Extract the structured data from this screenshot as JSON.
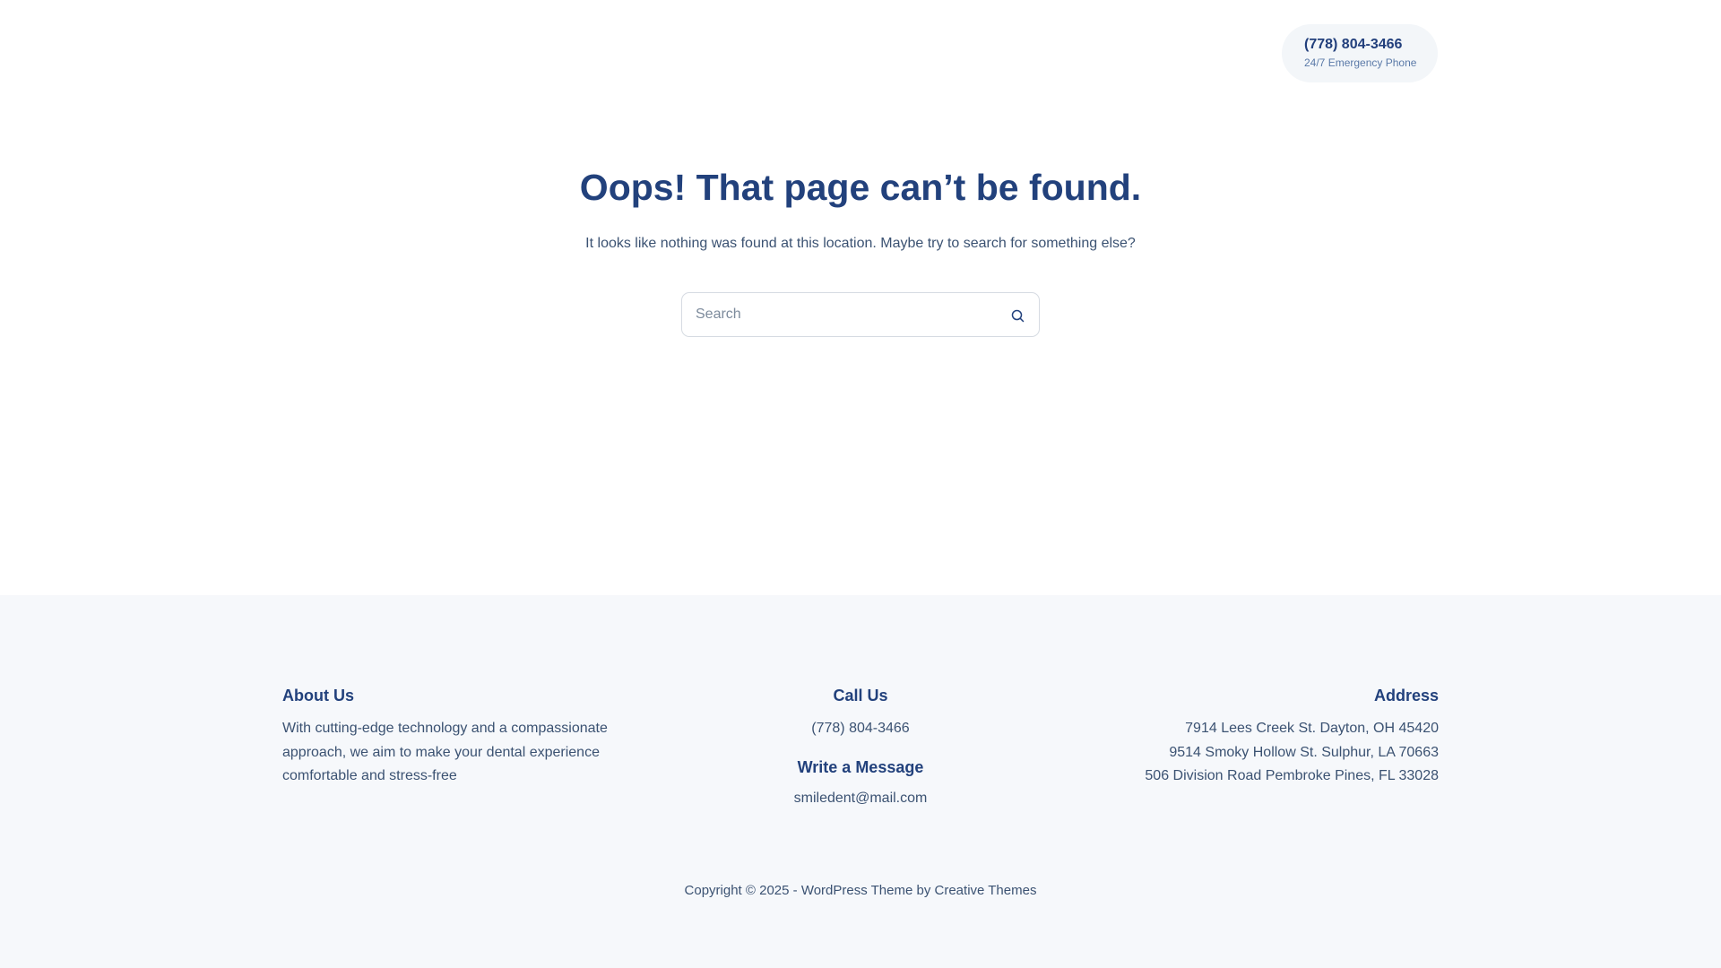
{
  "header": {
    "phone_number": "(778) 804-3466",
    "phone_caption": "24/7 Emergency Phone"
  },
  "main": {
    "title": "Oops! That page can’t be found.",
    "subtitle": "It looks like nothing was found at this location. Maybe try to search for something else?",
    "search": {
      "placeholder": "Search",
      "value": "",
      "icon": "search-icon"
    }
  },
  "footer": {
    "about": {
      "title": "About Us",
      "text": "With cutting-edge technology and a compassionate approach, we aim to make your dental experience comfortable and stress-free"
    },
    "call": {
      "title": "Call Us",
      "phone": "(778) 804-3466",
      "message_title": "Write a Message",
      "email": "smiledent@mail.com"
    },
    "address": {
      "title": "Address",
      "lines": [
        "7914 Lees Creek St. Dayton, OH 45420",
        "9514 Smoky Hollow St. Sulphur, LA 70663",
        "506 Division Road Pembroke Pines, FL 33028"
      ]
    },
    "copyright": {
      "prefix": "Copyright © 2025 - ",
      "link1": "WordPress Theme",
      "middle": " by ",
      "link2": "Creative Themes"
    }
  },
  "colors": {
    "heading": "#22417c",
    "text": "#3b5272",
    "footer_bg": "#f6f8fb",
    "pill_bg": "#f3f6f9"
  }
}
